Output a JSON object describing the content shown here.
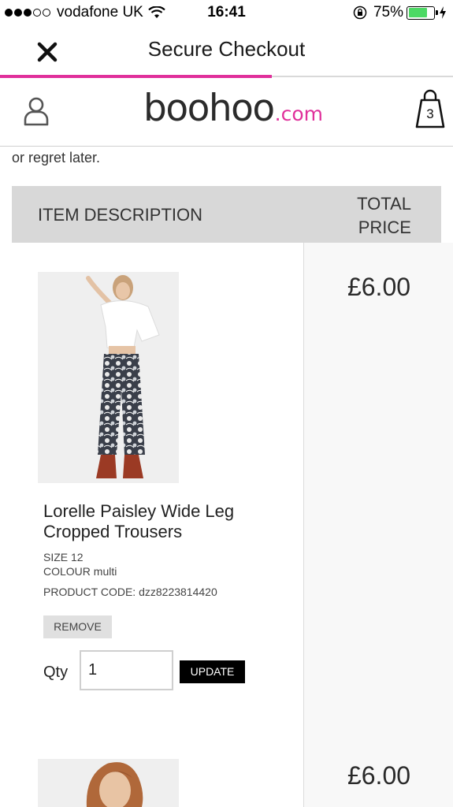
{
  "status_bar": {
    "carrier": "vodafone UK",
    "time": "16:41",
    "battery_percent": "75%",
    "battery_level": 0.75,
    "signal_bars_filled": 3,
    "signal_bars_total": 5
  },
  "nav": {
    "title": "Secure Checkout",
    "close_icon": "close-icon",
    "progress": 0.6
  },
  "brand": {
    "logo_main": "boohoo",
    "logo_suffix": ".com",
    "bag_count": "3",
    "accent_color": "#e0309b"
  },
  "intro_text": "or regret later.",
  "table": {
    "headers": {
      "item_description": "ITEM DESCRIPTION",
      "total_price_line1": "TOTAL",
      "total_price_line2": "PRICE"
    }
  },
  "items": [
    {
      "name": "Lorelle Paisley Wide Leg Cropped Trousers",
      "size": "SIZE 12",
      "colour": "COLOUR multi",
      "product_code": "PRODUCT CODE: dzz8223814420",
      "remove_label": "REMOVE",
      "qty_label": "Qty",
      "qty_value": "1",
      "update_label": "UPDATE",
      "price": "£6.00"
    },
    {
      "price": "£6.00"
    }
  ]
}
